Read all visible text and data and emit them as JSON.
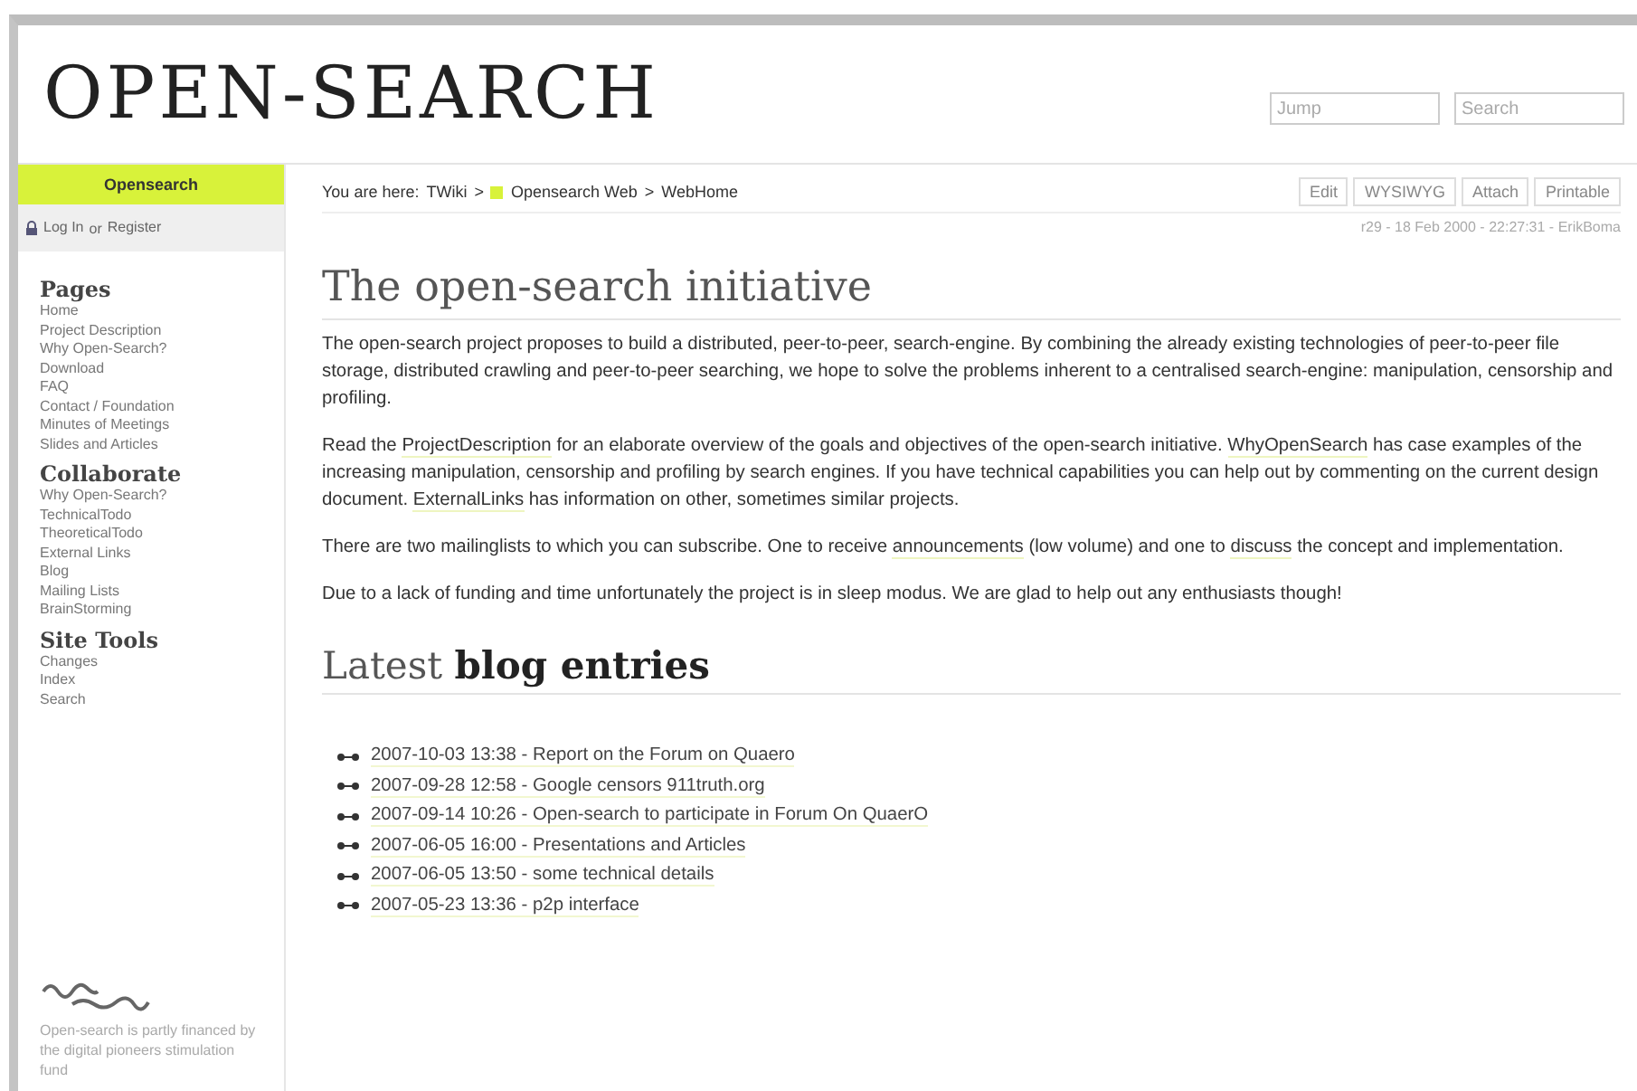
{
  "logo": "OPEN-SEARCH",
  "header": {
    "jump": {
      "placeholder": "Jump"
    },
    "search": {
      "placeholder": "Search"
    }
  },
  "sidebar": {
    "web_title": "Opensearch",
    "login": {
      "log_in": "Log In",
      "or": "or",
      "register": "Register"
    },
    "sections": [
      {
        "title": "Pages",
        "items": [
          "Home",
          "Project Description",
          "Why Open-Search?",
          "Download",
          "FAQ",
          "Contact / Foundation",
          "Minutes of Meetings",
          "Slides and Articles"
        ]
      },
      {
        "title": "Collaborate",
        "items": [
          "Why Open-Search?",
          "TechnicalTodo",
          "TheoreticalTodo",
          "External Links",
          "Blog",
          "Mailing Lists",
          "BrainStorming"
        ]
      },
      {
        "title": "Site Tools",
        "items": [
          "Changes",
          "Index",
          "Search"
        ]
      }
    ],
    "footer_note": "Open-search is partly financed by the digital pioneers stimulation fund"
  },
  "breadcrumb": {
    "prefix": "You are here:",
    "items": [
      "TWiki",
      ">",
      "Opensearch Web",
      ">",
      "WebHome"
    ]
  },
  "actions": [
    "Edit",
    "WYSIWYG",
    "Attach",
    "Printable"
  ],
  "revision": "r29 - 18 Feb 2000 - 22:27:31 - ErikBoma",
  "title": "The open-search initiative",
  "paragraphs": [
    [
      {
        "text": "The open-search project proposes to build a distributed, peer-to-peer, search-engine. By combining the already existing technologies of peer-to-peer file storage, distributed crawling and peer-to-peer searching, we hope to solve the problems inherent to a centralised search-engine: manipulation, censorship and profiling.",
        "link": false
      }
    ],
    [
      {
        "text": "Read the ",
        "link": false
      },
      {
        "text": "ProjectDescription",
        "link": true
      },
      {
        "text": " for an elaborate overview of the goals and objectives of the open-search initiative. ",
        "link": false
      },
      {
        "text": "WhyOpenSearch",
        "link": true
      },
      {
        "text": " has case examples of the increasing manipulation, censorship and profiling by search engines. If you have technical capabilities you can help out by commenting on the current design document. ",
        "link": false
      },
      {
        "text": "ExternalLinks",
        "link": true
      },
      {
        "text": " has information on other, sometimes similar projects.",
        "link": false
      }
    ],
    [
      {
        "text": "There are two mailinglists to which you can subscribe. One to receive ",
        "link": false
      },
      {
        "text": "announcements",
        "link": true
      },
      {
        "text": " (low volume) and one to ",
        "link": false
      },
      {
        "text": "discuss",
        "link": true
      },
      {
        "text": " the concept and implementation.",
        "link": false
      }
    ],
    [
      {
        "text": "Due to a lack of funding and time unfortunately the project is in sleep modus. We are glad to help out any enthusiasts though!",
        "link": false
      }
    ]
  ],
  "blog_heading": "Latest **blog entries**",
  "blog_entries": [
    {
      "text": "2007-10-03 13:38 - Report on the Forum on Quaero"
    },
    {
      "text": "2007-09-28 12:58 - Google censors 911truth.org"
    },
    {
      "text": "2007-09-14 10:26 - Open-search to participate in Forum On QuaerO"
    },
    {
      "text": "2007-06-05 16:00 - Presentations and Articles"
    },
    {
      "text": "2007-06-05 13:50 - some technical details"
    },
    {
      "text": "2007-05-23 13:36 - p2p interface"
    }
  ]
}
